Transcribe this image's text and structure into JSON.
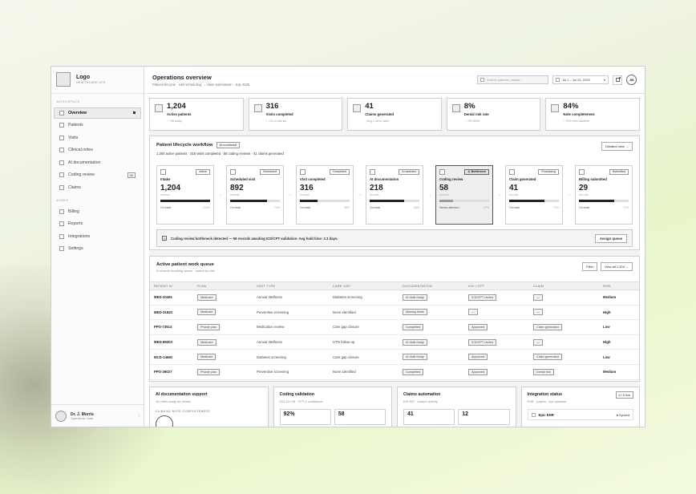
{
  "brand": {
    "name": "Logo",
    "sub": "HEALTHCARE OPS"
  },
  "sidebar": {
    "section_workspace": "WORKSPACE",
    "workspace": [
      {
        "label": "Overview",
        "active": true
      },
      {
        "label": "Patients"
      },
      {
        "label": "Visits"
      },
      {
        "label": "Clinical notes"
      },
      {
        "label": "AI documentation"
      },
      {
        "label": "Coding review",
        "badge": "58"
      },
      {
        "label": "Claims"
      }
    ],
    "section_admin": "ADMIN",
    "admin": [
      {
        "label": "Billing"
      },
      {
        "label": "Reports"
      },
      {
        "label": "Integrations"
      },
      {
        "label": "Settings"
      }
    ],
    "user": {
      "name": "Dr. J. Morris",
      "role": "Operations Lead"
    }
  },
  "header": {
    "title": "Operations overview",
    "subtitle": "Patient lifecycle · visit scheduling → claim submission · July 2025",
    "search_placeholder": "Search patients, claims...",
    "date_range": "Jul 1 – Jul 31, 2025",
    "avatar_initials": "JM"
  },
  "kpis": [
    {
      "value": "1,204",
      "label": "Active patients",
      "sub": "↑ +38 today"
    },
    {
      "value": "316",
      "label": "Visits completed",
      "sub": "↑ +12 vs last wk"
    },
    {
      "value": "41",
      "label": "Claims generated",
      "sub": "↑ Avg 1.4d to claim"
    },
    {
      "value": "8%",
      "label": "Denial risk rate",
      "sub": "↑ −2% MoM"
    },
    {
      "value": "84%",
      "label": "Note completeness",
      "sub": "↑ +5% from baseline"
    }
  ],
  "workflow": {
    "title": "Patient lifecycle workflow",
    "tag": "AI-monitored",
    "summary": "1,204 active patients · 316 visits completed · 58 coding reviews · 41 claims generated",
    "detail_button": "Detailed view →",
    "stages": [
      {
        "status": "Active",
        "name": "Intake",
        "value": "1,204",
        "unit": "records",
        "progress": 100,
        "state": "On track",
        "pct": "100%"
      },
      {
        "status": "Scheduled",
        "name": "Scheduled visit",
        "value": "892",
        "unit": "records",
        "progress": 74,
        "state": "On track",
        "pct": "74%"
      },
      {
        "status": "Completed",
        "name": "Visit completed",
        "value": "316",
        "unit": "records",
        "progress": 35,
        "state": "On track",
        "pct": "35%"
      },
      {
        "status": "AI-assisted",
        "name": "AI documentation",
        "value": "218",
        "unit": "records",
        "progress": 69,
        "state": "On track",
        "pct": "69%"
      },
      {
        "status": "⚠ Bottleneck",
        "name": "Coding review",
        "value": "58",
        "unit": "records",
        "progress": 27,
        "state": "Needs attention",
        "pct": "27%",
        "hot": true
      },
      {
        "status": "Processing",
        "name": "Claim generated",
        "value": "41",
        "unit": "records",
        "progress": 71,
        "state": "On track",
        "pct": "71%"
      },
      {
        "status": "Submitted",
        "name": "Billing submitted",
        "value": "29",
        "unit": "records",
        "progress": 71,
        "state": "On track",
        "pct": "71%"
      }
    ],
    "alert_icon": "!",
    "alert_text": "Coding review bottleneck detected — 58 records awaiting ICD/CPT validation. Avg hold time: 2.3 days.",
    "alert_button": "Assign queue"
  },
  "queue": {
    "title": "Active patient work queue",
    "subtitle": "6 records requiring action · sorted by risk",
    "filter_button": "Filter",
    "view_all_button": "View all 1,204 →",
    "columns": [
      "PATIENT ID",
      "PLAN",
      "VISIT TYPE",
      "CARE GAP",
      "DOCUMENTATION",
      "ICD / CPT",
      "CLAIM",
      "RISK"
    ],
    "rows": [
      {
        "id": "MED-20491",
        "plan": "Medicare",
        "visit": "Annual Wellness",
        "gap": "Diabetes screening",
        "doc": "AI draft ready",
        "icd": "ICD/CPT review",
        "claim": "—",
        "risk": "Medium"
      },
      {
        "id": "MED-31820",
        "plan": "Medicaid",
        "visit": "Preventive screening",
        "gap": "None identified",
        "doc": "Missing fields",
        "icd": "—",
        "claim": "—",
        "risk": "High"
      },
      {
        "id": "PPO-73514",
        "plan": "Private plan",
        "visit": "Medication review",
        "gap": "Care gap closure",
        "doc": "Completed",
        "icd": "Approved",
        "claim": "Claim generated",
        "risk": "Low"
      },
      {
        "id": "MED-89203",
        "plan": "Medicare",
        "visit": "Annual Wellness",
        "gap": "HTN follow-up",
        "doc": "AI draft ready",
        "icd": "ICD/CPT review",
        "claim": "—",
        "risk": "High"
      },
      {
        "id": "MCD-14682",
        "plan": "Medicaid",
        "visit": "Diabetes screening",
        "gap": "Care gap closure",
        "doc": "AI draft ready",
        "icd": "Approved",
        "claim": "Claim generated",
        "risk": "Low"
      },
      {
        "id": "PPO-39027",
        "plan": "Private plan",
        "visit": "Preventive screening",
        "gap": "None identified",
        "doc": "Completed",
        "icd": "Approved",
        "claim": "Denial risk",
        "risk": "Medium"
      }
    ]
  },
  "bottom": {
    "ai_doc": {
      "title": "AI documentation support",
      "sub": "12 notes ready for review",
      "label": "CLINICAL NOTE COMPLETENESS"
    },
    "coding": {
      "title": "Coding validation",
      "sub": "ICD-10-CM · CPT-4 confidence",
      "v1": "92%",
      "v2": "58"
    },
    "claims": {
      "title": "Claims automation",
      "sub": "EDI 837 · today's activity",
      "v1": "41",
      "v2": "12"
    },
    "integration": {
      "title": "Integration status",
      "sub": "EHR · payers · ops systems",
      "badge": "4 / 5 live",
      "row_name": "Epic EHR",
      "row_status": "● Synced"
    }
  }
}
